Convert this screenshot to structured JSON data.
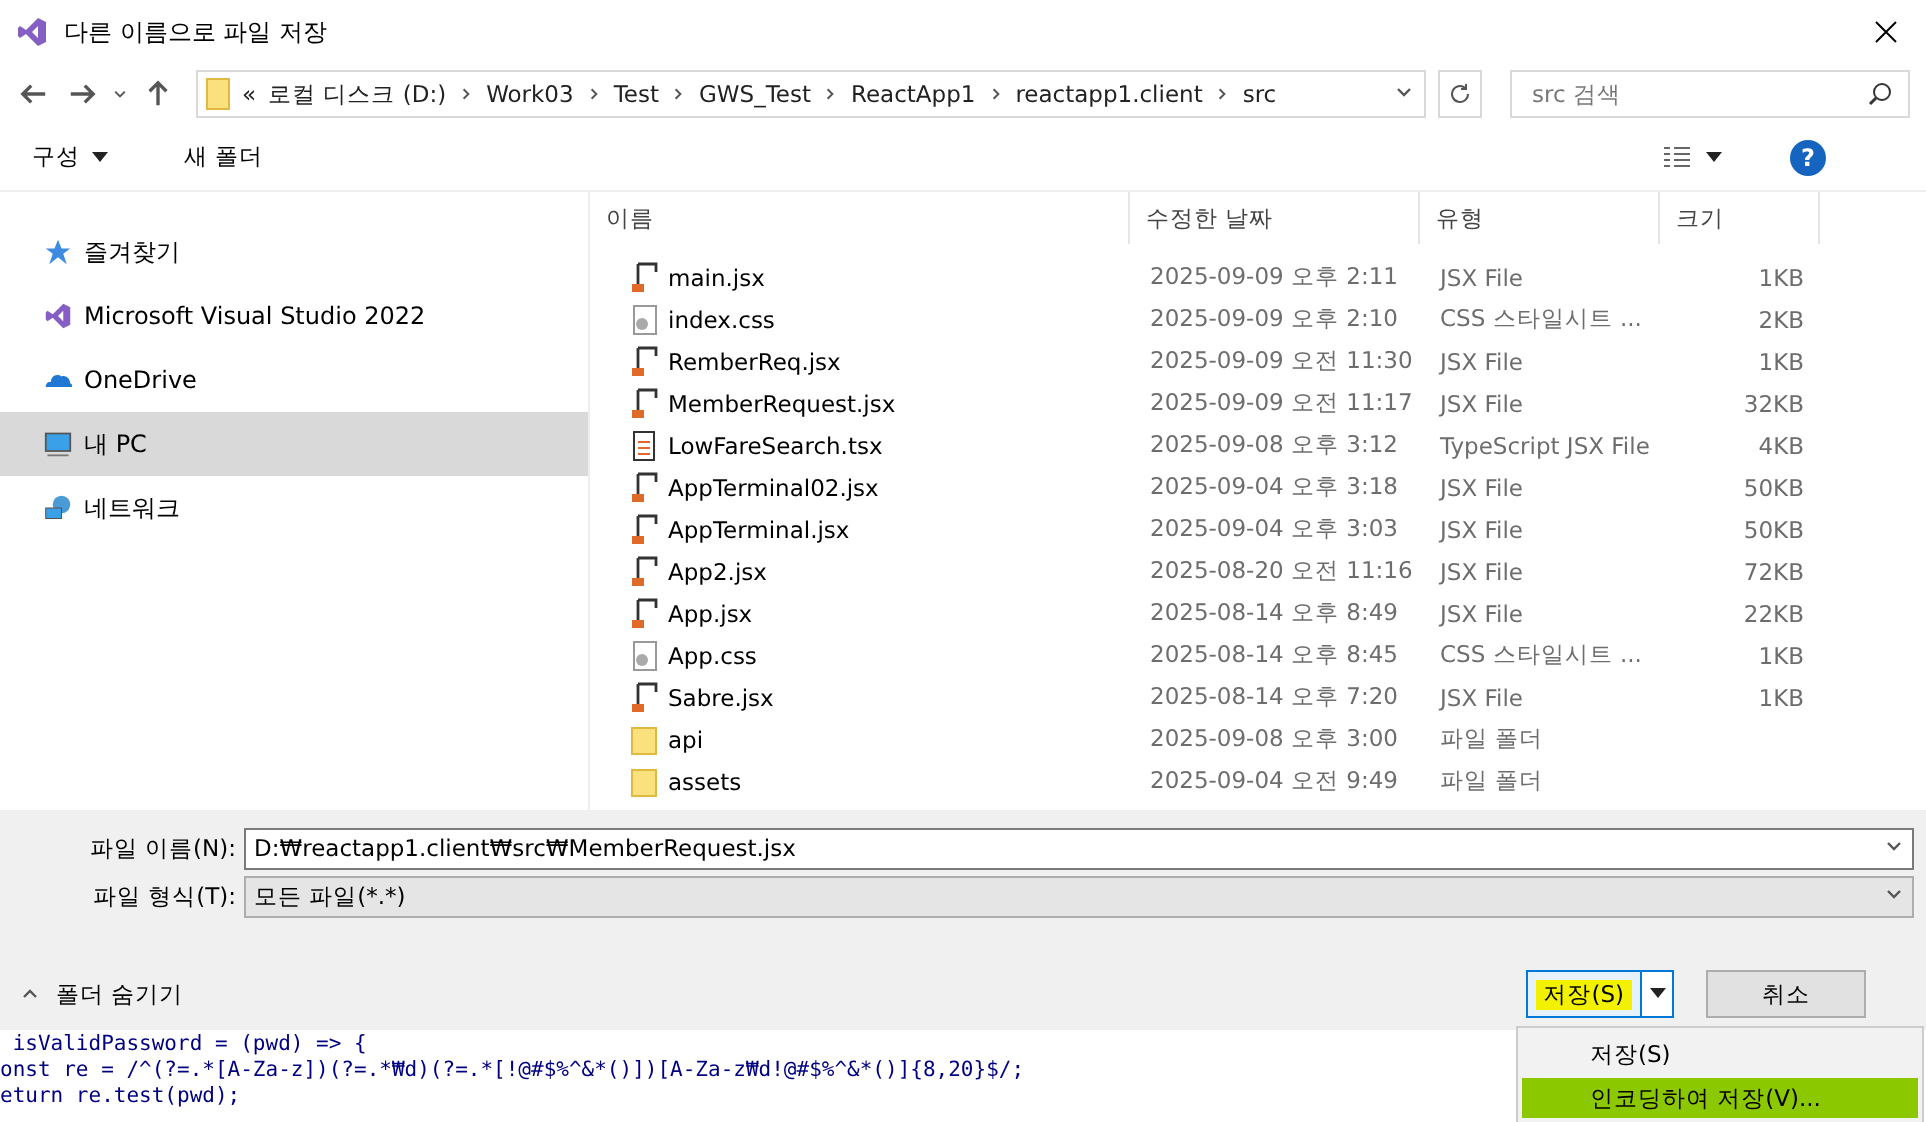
{
  "window": {
    "title": "다른 이름으로 파일 저장"
  },
  "address_bar": {
    "overflow": "«",
    "path": [
      "로컬 디스크 (D:)",
      "Work03",
      "Test",
      "GWS_Test",
      "ReactApp1",
      "reactapp1.client",
      "src"
    ]
  },
  "search": {
    "placeholder": "src 검색"
  },
  "toolbar": {
    "items": [
      "구성",
      "새 폴더"
    ],
    "help": "?"
  },
  "sidebar": {
    "items": [
      {
        "label": "즐겨찾기",
        "kind": "star",
        "selected": false
      },
      {
        "label": "Microsoft Visual Studio 2022",
        "kind": "vs",
        "selected": false
      },
      {
        "label": "OneDrive",
        "kind": "cloud",
        "selected": false
      },
      {
        "label": "내 PC",
        "kind": "pc",
        "selected": true
      },
      {
        "label": "네트워크",
        "kind": "network",
        "selected": false
      }
    ]
  },
  "table": {
    "columns": [
      "이름",
      "수정한 날짜",
      "유형",
      "크기"
    ],
    "rows": [
      {
        "kind": "jsx",
        "name": "main.jsx",
        "date": "2025-09-09 오후 2:11",
        "type": "JSX File",
        "size": "1KB"
      },
      {
        "kind": "css",
        "name": "index.css",
        "date": "2025-09-09 오후 2:10",
        "type": "CSS 스타일시트 ...",
        "size": "2KB"
      },
      {
        "kind": "jsx",
        "name": "RemberReq.jsx",
        "date": "2025-09-09 오전 11:30",
        "type": "JSX File",
        "size": "1KB"
      },
      {
        "kind": "jsx",
        "name": "MemberRequest.jsx",
        "date": "2025-09-09 오전 11:17",
        "type": "JSX File",
        "size": "32KB"
      },
      {
        "kind": "tsx",
        "name": "LowFareSearch.tsx",
        "date": "2025-09-08 오후 3:12",
        "type": "TypeScript JSX File",
        "size": "4KB"
      },
      {
        "kind": "jsx",
        "name": "AppTerminal02.jsx",
        "date": "2025-09-04 오후 3:18",
        "type": "JSX File",
        "size": "50KB"
      },
      {
        "kind": "jsx",
        "name": "AppTerminal.jsx",
        "date": "2025-09-04 오후 3:03",
        "type": "JSX File",
        "size": "50KB"
      },
      {
        "kind": "jsx",
        "name": "App2.jsx",
        "date": "2025-08-20 오전 11:16",
        "type": "JSX File",
        "size": "72KB"
      },
      {
        "kind": "jsx",
        "name": "App.jsx",
        "date": "2025-08-14 오후 8:49",
        "type": "JSX File",
        "size": "22KB"
      },
      {
        "kind": "css",
        "name": "App.css",
        "date": "2025-08-14 오후 8:45",
        "type": "CSS 스타일시트 ...",
        "size": "1KB"
      },
      {
        "kind": "jsx",
        "name": "Sabre.jsx",
        "date": "2025-08-14 오후 7:20",
        "type": "JSX File",
        "size": "1KB"
      },
      {
        "kind": "folder",
        "name": "api",
        "date": "2025-09-08 오후 3:00",
        "type": "파일 폴더",
        "size": ""
      },
      {
        "kind": "folder",
        "name": "assets",
        "date": "2025-09-04 오전 9:49",
        "type": "파일 폴더",
        "size": ""
      }
    ]
  },
  "filename": {
    "label": "파일 이름(N):",
    "value": "D:₩reactapp1.client₩src₩MemberRequest.jsx"
  },
  "filetype": {
    "label": "파일 형식(T):",
    "value": "모든 파일(*.*)"
  },
  "hide_folders": {
    "label": "폴더 숨기기"
  },
  "buttons": [
    {
      "label": "저장(S)",
      "kind": "split",
      "highlighted": true
    },
    {
      "label": "취소",
      "kind": "plain",
      "highlighted": false
    }
  ],
  "menu": {
    "items": [
      {
        "label": "저장(S)",
        "highlighted": false
      },
      {
        "label": "인코딩하여 저장(V)...",
        "highlighted": true
      }
    ]
  },
  "code": {
    "lines": [
      " isValidPassword = (pwd) => {",
      "onst re = /^(?=.*[A-Za-z])(?=.*₩d)(?=.*[!@#$%^&*()])[A-Za-z₩d!@#$%^&*()]{8,20}$/;",
      "eturn re.test(pwd);"
    ]
  }
}
